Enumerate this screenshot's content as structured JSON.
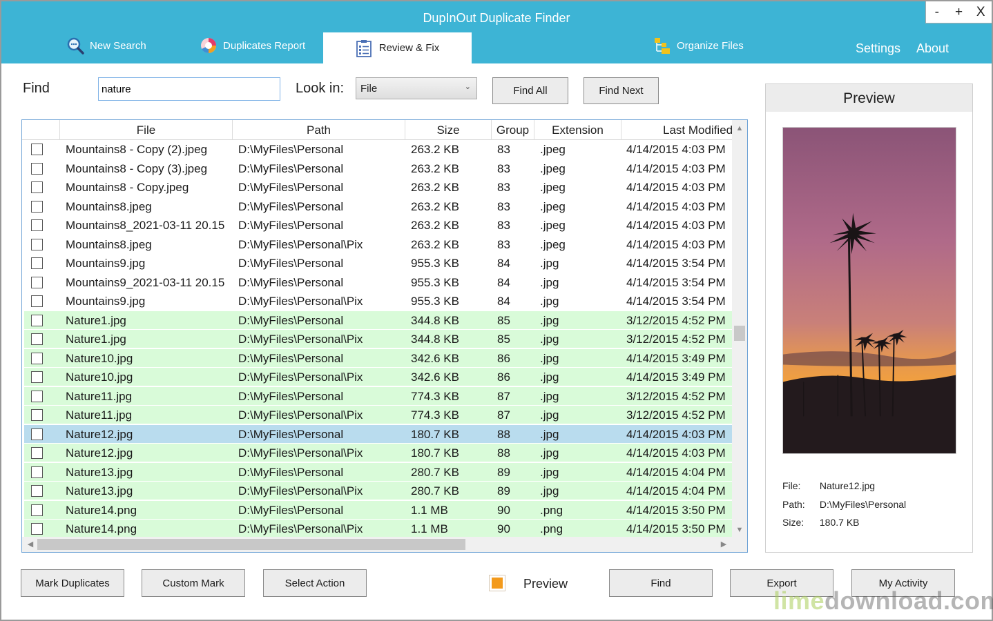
{
  "window": {
    "title": "DupInOut Duplicate Finder",
    "controls": [
      "-",
      "+",
      "X"
    ]
  },
  "tabs": [
    {
      "label": "New Search",
      "icon": "magnifier-icon"
    },
    {
      "label": "Duplicates Report",
      "icon": "pie-chart-icon"
    },
    {
      "label": "Review & Fix",
      "icon": "checklist-icon",
      "active": true
    },
    {
      "label": "Organize Files",
      "icon": "folders-icon"
    }
  ],
  "nav": {
    "settings": "Settings",
    "about": "About"
  },
  "find": {
    "label": "Find",
    "value": "nature",
    "lookin_label": "Look in:",
    "lookin_value": "File",
    "find_all": "Find All",
    "find_next": "Find Next"
  },
  "grid": {
    "columns": [
      "File",
      "Path",
      "Size",
      "Group",
      "Extension",
      "Last Modified"
    ],
    "rows": [
      {
        "file": "Mountains8 - Copy (2).jpeg",
        "path": "D:\\MyFiles\\Personal",
        "size": "263.2 KB",
        "group": "83",
        "ext": ".jpeg",
        "modified": "4/14/2015 4:03 PM",
        "style": "white"
      },
      {
        "file": "Mountains8 - Copy (3).jpeg",
        "path": "D:\\MyFiles\\Personal",
        "size": "263.2 KB",
        "group": "83",
        "ext": ".jpeg",
        "modified": "4/14/2015 4:03 PM",
        "style": "white"
      },
      {
        "file": "Mountains8 - Copy.jpeg",
        "path": "D:\\MyFiles\\Personal",
        "size": "263.2 KB",
        "group": "83",
        "ext": ".jpeg",
        "modified": "4/14/2015 4:03 PM",
        "style": "white"
      },
      {
        "file": "Mountains8.jpeg",
        "path": "D:\\MyFiles\\Personal",
        "size": "263.2 KB",
        "group": "83",
        "ext": ".jpeg",
        "modified": "4/14/2015 4:03 PM",
        "style": "white"
      },
      {
        "file": "Mountains8_2021-03-11 20.15",
        "path": "D:\\MyFiles\\Personal",
        "size": "263.2 KB",
        "group": "83",
        "ext": ".jpeg",
        "modified": "4/14/2015 4:03 PM",
        "style": "white"
      },
      {
        "file": "Mountains8.jpeg",
        "path": "D:\\MyFiles\\Personal\\Pix",
        "size": "263.2 KB",
        "group": "83",
        "ext": ".jpeg",
        "modified": "4/14/2015 4:03 PM",
        "style": "white"
      },
      {
        "file": "Mountains9.jpg",
        "path": "D:\\MyFiles\\Personal",
        "size": "955.3 KB",
        "group": "84",
        "ext": ".jpg",
        "modified": "4/14/2015 3:54 PM",
        "style": "white"
      },
      {
        "file": "Mountains9_2021-03-11 20.15",
        "path": "D:\\MyFiles\\Personal",
        "size": "955.3 KB",
        "group": "84",
        "ext": ".jpg",
        "modified": "4/14/2015 3:54 PM",
        "style": "white"
      },
      {
        "file": "Mountains9.jpg",
        "path": "D:\\MyFiles\\Personal\\Pix",
        "size": "955.3 KB",
        "group": "84",
        "ext": ".jpg",
        "modified": "4/14/2015 3:54 PM",
        "style": "white"
      },
      {
        "file": "Nature1.jpg",
        "path": "D:\\MyFiles\\Personal",
        "size": "344.8 KB",
        "group": "85",
        "ext": ".jpg",
        "modified": "3/12/2015 4:52 PM",
        "style": "green"
      },
      {
        "file": "Nature1.jpg",
        "path": "D:\\MyFiles\\Personal\\Pix",
        "size": "344.8 KB",
        "group": "85",
        "ext": ".jpg",
        "modified": "3/12/2015 4:52 PM",
        "style": "green"
      },
      {
        "file": "Nature10.jpg",
        "path": "D:\\MyFiles\\Personal",
        "size": "342.6 KB",
        "group": "86",
        "ext": ".jpg",
        "modified": "4/14/2015 3:49 PM",
        "style": "green"
      },
      {
        "file": "Nature10.jpg",
        "path": "D:\\MyFiles\\Personal\\Pix",
        "size": "342.6 KB",
        "group": "86",
        "ext": ".jpg",
        "modified": "4/14/2015 3:49 PM",
        "style": "green"
      },
      {
        "file": "Nature11.jpg",
        "path": "D:\\MyFiles\\Personal",
        "size": "774.3 KB",
        "group": "87",
        "ext": ".jpg",
        "modified": "3/12/2015 4:52 PM",
        "style": "green"
      },
      {
        "file": "Nature11.jpg",
        "path": "D:\\MyFiles\\Personal\\Pix",
        "size": "774.3 KB",
        "group": "87",
        "ext": ".jpg",
        "modified": "3/12/2015 4:52 PM",
        "style": "green"
      },
      {
        "file": "Nature12.jpg",
        "path": "D:\\MyFiles\\Personal",
        "size": "180.7 KB",
        "group": "88",
        "ext": ".jpg",
        "modified": "4/14/2015 4:03 PM",
        "style": "sel"
      },
      {
        "file": "Nature12.jpg",
        "path": "D:\\MyFiles\\Personal\\Pix",
        "size": "180.7 KB",
        "group": "88",
        "ext": ".jpg",
        "modified": "4/14/2015 4:03 PM",
        "style": "green"
      },
      {
        "file": "Nature13.jpg",
        "path": "D:\\MyFiles\\Personal",
        "size": "280.7 KB",
        "group": "89",
        "ext": ".jpg",
        "modified": "4/14/2015 4:04 PM",
        "style": "green"
      },
      {
        "file": "Nature13.jpg",
        "path": "D:\\MyFiles\\Personal\\Pix",
        "size": "280.7 KB",
        "group": "89",
        "ext": ".jpg",
        "modified": "4/14/2015 4:04 PM",
        "style": "green"
      },
      {
        "file": "Nature14.png",
        "path": "D:\\MyFiles\\Personal",
        "size": "1.1 MB",
        "group": "90",
        "ext": ".png",
        "modified": "4/14/2015 3:50 PM",
        "style": "green"
      },
      {
        "file": "Nature14.png",
        "path": "D:\\MyFiles\\Personal\\Pix",
        "size": "1.1 MB",
        "group": "90",
        "ext": ".png",
        "modified": "4/14/2015 3:50 PM",
        "style": "green"
      }
    ]
  },
  "preview": {
    "title": "Preview",
    "file_label": "File:",
    "file": "Nature12.jpg",
    "path_label": "Path:",
    "path": "D:\\MyFiles\\Personal",
    "size_label": "Size:",
    "size": "180.7 KB"
  },
  "bottom": {
    "mark_duplicates": "Mark Duplicates",
    "custom_mark": "Custom Mark",
    "select_action": "Select Action",
    "preview_toggle": "Preview",
    "find": "Find",
    "export": "Export",
    "my_activity": "My Activity"
  },
  "watermark": {
    "part1": "lime",
    "part2": "download.com"
  },
  "colors": {
    "accent": "#3db4d5",
    "row_green": "#d9fbd9",
    "row_selected": "#b9dcee",
    "preview_toggle": "#f39a1c"
  }
}
